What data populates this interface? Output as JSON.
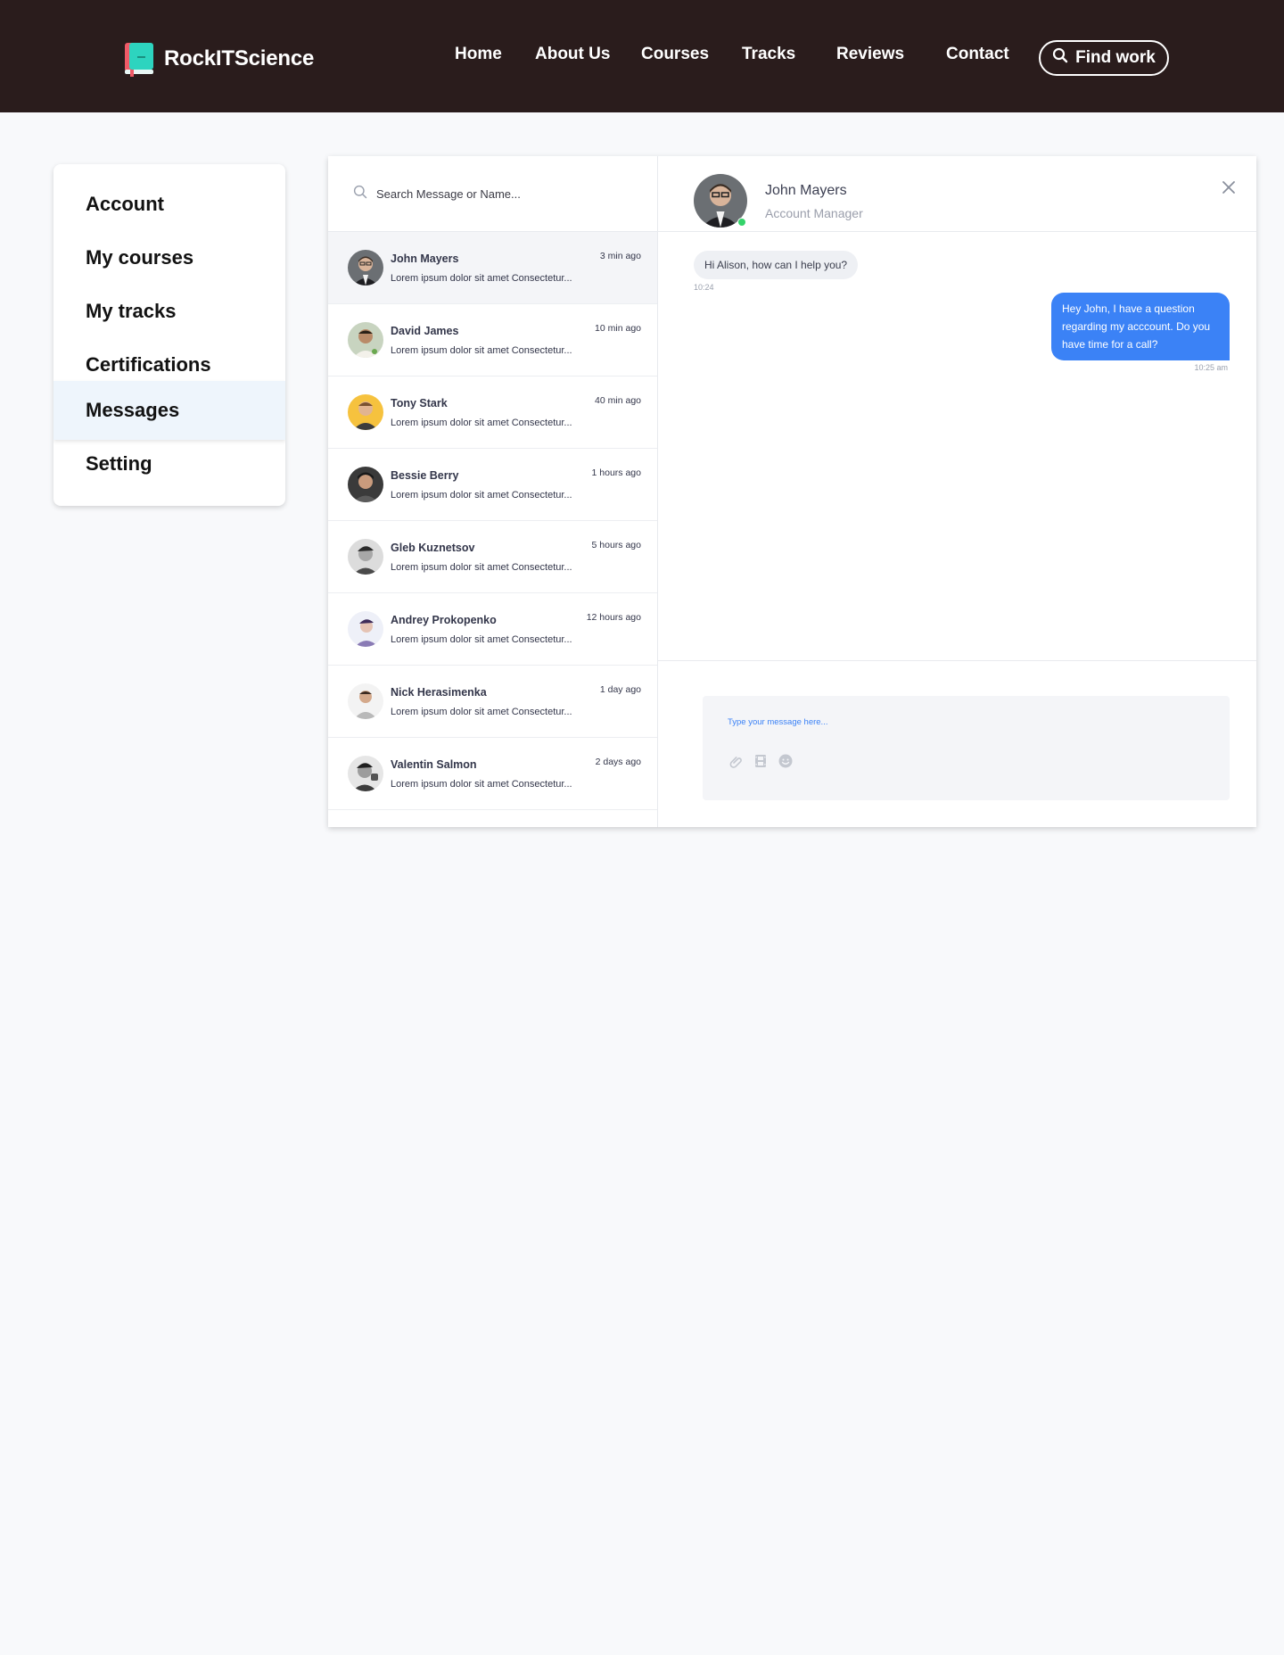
{
  "brand": {
    "name": "RockITScience"
  },
  "nav": {
    "links": [
      "Home",
      "About Us",
      "Courses",
      "Tracks",
      "Reviews",
      "Contact"
    ],
    "find_work": "Find work"
  },
  "sidebar": {
    "items": [
      {
        "label": "Account",
        "active": false
      },
      {
        "label": "My courses",
        "active": false
      },
      {
        "label": "My tracks",
        "active": false
      },
      {
        "label": "Certifications",
        "active": false
      },
      {
        "label": "Messages",
        "active": true
      },
      {
        "label": "Setting",
        "active": false
      }
    ]
  },
  "search": {
    "placeholder": "Search Message or Name..."
  },
  "conversations": [
    {
      "name": "John Mayers",
      "time": "3 min ago",
      "preview": "Lorem ipsum dolor sit amet Consectetur...",
      "active": true
    },
    {
      "name": "David James",
      "time": "10 min ago",
      "preview": "Lorem ipsum dolor sit amet Consectetur..."
    },
    {
      "name": "Tony Stark",
      "time": "40 min ago",
      "preview": "Lorem ipsum dolor sit amet Consectetur..."
    },
    {
      "name": "Bessie Berry",
      "time": "1 hours ago",
      "preview": "Lorem ipsum dolor sit amet Consectetur..."
    },
    {
      "name": "Gleb Kuznetsov",
      "time": "5 hours ago",
      "preview": "Lorem ipsum dolor sit amet Consectetur..."
    },
    {
      "name": "Andrey Prokopenko",
      "time": "12 hours ago",
      "preview": "Lorem ipsum dolor sit amet Consectetur..."
    },
    {
      "name": "Nick Herasimenka",
      "time": "1 day ago",
      "preview": "Lorem ipsum dolor sit amet Consectetur..."
    },
    {
      "name": "Valentin Salmon",
      "time": "2 days ago",
      "preview": "Lorem ipsum dolor sit amet Consectetur..."
    }
  ],
  "chat": {
    "contact_name": "John Mayers",
    "contact_role": "Account Manager",
    "messages": [
      {
        "direction": "incoming",
        "text": "Hi Alison, how can I help you?",
        "time": "10:24"
      },
      {
        "direction": "outgoing",
        "text": "Hey John, I have a question regarding my acccount. Do you have time for a call?",
        "time": "10:25 am"
      }
    ],
    "composer_placeholder": "Type your message here..."
  },
  "colors": {
    "header_bg": "#2a1c1c",
    "accent_blue": "#3b82f6",
    "online_green": "#34d36a",
    "active_menu_bg": "#eef5fc",
    "logo_teal": "#2dd4bf",
    "logo_red": "#f05a67"
  },
  "icons": {
    "find_work": "search-icon",
    "search": "search-icon",
    "close": "close-icon",
    "attach": "paperclip-icon",
    "media": "film-icon",
    "emoji": "smiley-icon"
  }
}
